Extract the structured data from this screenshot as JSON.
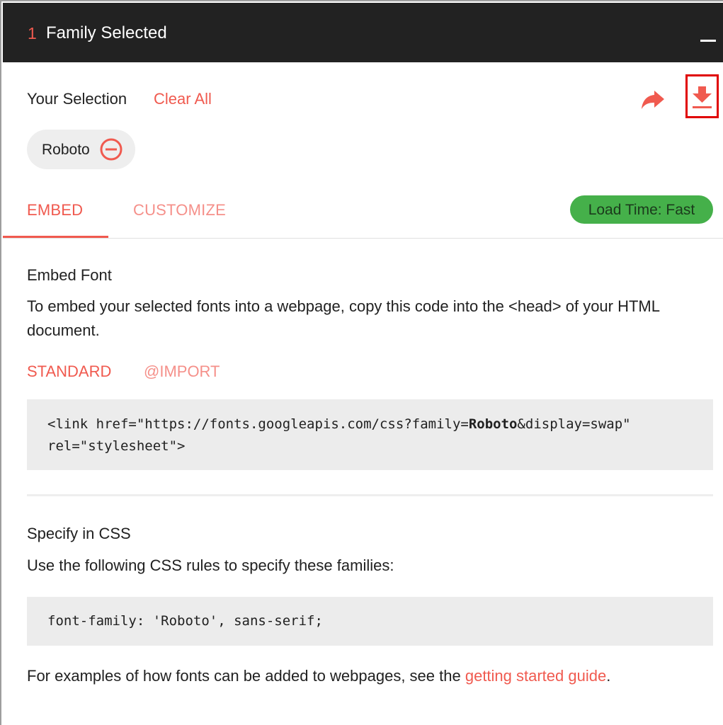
{
  "header": {
    "count": "1",
    "title": "Family Selected",
    "minimize_icon": "minimize-icon"
  },
  "selection": {
    "title": "Your Selection",
    "clear_all": "Clear All",
    "share_icon": "share-arrow-icon",
    "download_icon": "download-icon",
    "chips": [
      {
        "label": "Roboto",
        "remove_icon": "remove-circle-icon"
      }
    ]
  },
  "tabs": {
    "embed": "EMBED",
    "customize": "CUSTOMIZE",
    "active": "EMBED"
  },
  "load_time": "Load Time: Fast",
  "embed": {
    "heading": "Embed Font",
    "description": "To embed your selected fonts into a webpage, copy this code into the <head> of your HTML document.",
    "subtabs": {
      "standard": "STANDARD",
      "import": "@IMPORT",
      "active": "STANDARD"
    },
    "code": {
      "line1_prefix": "<link href=\"https://fonts.googleapis.com/css?family=",
      "line1_family": "Roboto",
      "line1_suffix": "&display=swap\"",
      "line2": "rel=\"stylesheet\">"
    }
  },
  "css": {
    "heading": "Specify in CSS",
    "description": "Use the following CSS rules to specify these families:",
    "code": "font-family: 'Roboto', sans-serif;"
  },
  "footer": {
    "text": "For examples of how fonts can be added to webpages, see the ",
    "link": "getting started guide",
    "suffix": "."
  },
  "colors": {
    "accent": "#f05a4f",
    "accent_light": "#f5908a",
    "header_bg": "#222222",
    "badge_green": "#45b04a",
    "highlight_box": "#e00000"
  }
}
